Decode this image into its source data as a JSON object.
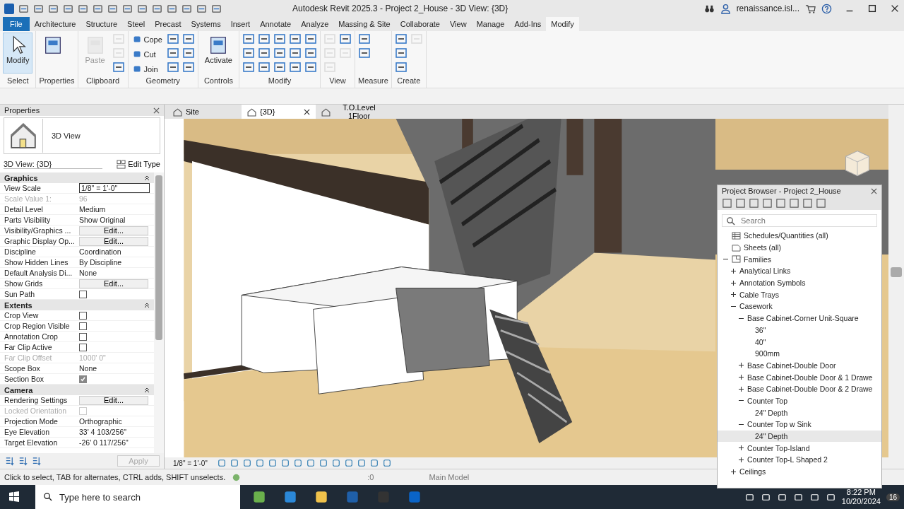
{
  "title_bar": {
    "title": "Autodesk Revit 2025.3 - Project 2_House - 3D View: {3D}",
    "user": "renaissance.isl..."
  },
  "menu_tabs": [
    {
      "label": "File",
      "kind": "file",
      "selected": false
    },
    {
      "label": "Architecture",
      "kind": "tab",
      "selected": false
    },
    {
      "label": "Structure",
      "kind": "tab",
      "selected": false
    },
    {
      "label": "Steel",
      "kind": "tab",
      "selected": false
    },
    {
      "label": "Precast",
      "kind": "tab",
      "selected": false
    },
    {
      "label": "Systems",
      "kind": "tab",
      "selected": false
    },
    {
      "label": "Insert",
      "kind": "tab",
      "selected": false
    },
    {
      "label": "Annotate",
      "kind": "tab",
      "selected": false
    },
    {
      "label": "Analyze",
      "kind": "tab",
      "selected": false
    },
    {
      "label": "Massing & Site",
      "kind": "tab",
      "selected": false
    },
    {
      "label": "Collaborate",
      "kind": "tab",
      "selected": false
    },
    {
      "label": "View",
      "kind": "tab",
      "selected": false
    },
    {
      "label": "Manage",
      "kind": "tab",
      "selected": false
    },
    {
      "label": "Add-Ins",
      "kind": "tab",
      "selected": false
    },
    {
      "label": "Modify",
      "kind": "tab",
      "selected": true
    }
  ],
  "ribbon": [
    {
      "label": "Select",
      "tools": [
        {
          "kind": "large",
          "label": "Modify",
          "selected": true,
          "disabled": false
        }
      ]
    },
    {
      "label": "Properties",
      "tools": [
        {
          "kind": "large",
          "selected": false,
          "disabled": false
        }
      ]
    },
    {
      "label": "Clipboard",
      "tools": [
        {
          "kind": "large",
          "label": "Paste",
          "selected": false,
          "disabled": true
        },
        {
          "kind": "icon",
          "disabled": true
        },
        {
          "kind": "icon",
          "disabled": true
        },
        {
          "kind": "icon",
          "disabled": false
        }
      ]
    },
    {
      "label": "Geometry",
      "tools": [
        {
          "kind": "small",
          "label": "Cope",
          "disabled": false
        },
        {
          "kind": "small",
          "label": "Cut",
          "disabled": false
        },
        {
          "kind": "small",
          "label": "Join",
          "disabled": false
        },
        {
          "kind": "icon",
          "disabled": false
        },
        {
          "kind": "icon",
          "disabled": false
        },
        {
          "kind": "icon",
          "disabled": false
        },
        {
          "kind": "icon",
          "disabled": false
        },
        {
          "kind": "icon",
          "disabled": false
        },
        {
          "kind": "icon",
          "disabled": false
        }
      ]
    },
    {
      "label": "Controls",
      "tools": [
        {
          "kind": "large",
          "label": "Activate",
          "selected": false,
          "disabled": false
        }
      ]
    },
    {
      "label": "Modify",
      "tools": [
        {
          "kind": "icon",
          "disabled": false
        },
        {
          "kind": "icon",
          "disabled": false
        },
        {
          "kind": "icon",
          "disabled": false
        },
        {
          "kind": "icon",
          "disabled": false
        },
        {
          "kind": "icon",
          "disabled": false
        },
        {
          "kind": "icon",
          "disabled": false
        },
        {
          "kind": "icon",
          "disabled": false
        },
        {
          "kind": "icon",
          "disabled": false
        },
        {
          "kind": "icon",
          "disabled": false
        },
        {
          "kind": "icon",
          "disabled": false
        },
        {
          "kind": "icon",
          "disabled": false
        },
        {
          "kind": "icon",
          "disabled": false
        },
        {
          "kind": "icon",
          "disabled": false
        },
        {
          "kind": "icon",
          "disabled": false
        },
        {
          "kind": "icon",
          "disabled": false
        }
      ]
    },
    {
      "label": "View",
      "tools": [
        {
          "kind": "icon",
          "disabled": true
        },
        {
          "kind": "icon",
          "disabled": true
        },
        {
          "kind": "icon",
          "disabled": true
        },
        {
          "kind": "icon",
          "disabled": false
        },
        {
          "kind": "icon",
          "disabled": true
        }
      ]
    },
    {
      "label": "Measure",
      "tools": [
        {
          "kind": "icon",
          "disabled": false
        },
        {
          "kind": "icon",
          "disabled": false
        }
      ]
    },
    {
      "label": "Create",
      "tools": [
        {
          "kind": "icon",
          "disabled": false
        },
        {
          "kind": "icon",
          "disabled": false
        },
        {
          "kind": "icon",
          "disabled": false
        },
        {
          "kind": "icon",
          "disabled": true
        }
      ]
    }
  ],
  "properties": {
    "title": "Properties",
    "type_name": "3D View",
    "instance": "3D View: {3D}",
    "edit_type": "Edit Type",
    "apply": "Apply",
    "sections": [
      {
        "name": "Graphics",
        "rows": [
          {
            "label": "View Scale",
            "kind": "field",
            "value": "1/8\" = 1'-0\"",
            "disabled": false
          },
          {
            "label": "Scale Value    1:",
            "kind": "text",
            "value": "96",
            "disabled": true
          },
          {
            "label": "Detail Level",
            "kind": "text",
            "value": "Medium",
            "disabled": false
          },
          {
            "label": "Parts Visibility",
            "kind": "text",
            "value": "Show Original",
            "disabled": false
          },
          {
            "label": "Visibility/Graphics ...",
            "kind": "button",
            "value": "Edit...",
            "disabled": false
          },
          {
            "label": "Graphic Display Op...",
            "kind": "button",
            "value": "Edit...",
            "disabled": false
          },
          {
            "label": "Discipline",
            "kind": "text",
            "value": "Coordination",
            "disabled": false
          },
          {
            "label": "Show Hidden Lines",
            "kind": "text",
            "value": "By Discipline",
            "disabled": false
          },
          {
            "label": "Default Analysis Di...",
            "kind": "text",
            "value": "None",
            "disabled": false
          },
          {
            "label": "Show Grids",
            "kind": "button",
            "value": "Edit...",
            "disabled": false
          },
          {
            "label": "Sun Path",
            "kind": "checkbox",
            "checked": false,
            "disabled": false
          }
        ]
      },
      {
        "name": "Extents",
        "rows": [
          {
            "label": "Crop View",
            "kind": "checkbox",
            "checked": false,
            "disabled": false
          },
          {
            "label": "Crop Region Visible",
            "kind": "checkbox",
            "checked": false,
            "disabled": false
          },
          {
            "label": "Annotation Crop",
            "kind": "checkbox",
            "checked": false,
            "disabled": false
          },
          {
            "label": "Far Clip Active",
            "kind": "checkbox",
            "checked": false,
            "disabled": false
          },
          {
            "label": "Far Clip Offset",
            "kind": "text",
            "value": "1000'  0\"",
            "disabled": true
          },
          {
            "label": "Scope Box",
            "kind": "text",
            "value": "None",
            "disabled": false
          },
          {
            "label": "Section Box",
            "kind": "checkbox",
            "checked": true,
            "disabled": false
          }
        ]
      },
      {
        "name": "Camera",
        "rows": [
          {
            "label": "Rendering Settings",
            "kind": "button",
            "value": "Edit...",
            "disabled": false
          },
          {
            "label": "Locked Orientation",
            "kind": "checkbox",
            "checked": false,
            "disabled": true
          },
          {
            "label": "Projection Mode",
            "kind": "text",
            "value": "Orthographic",
            "disabled": false
          },
          {
            "label": "Eye Elevation",
            "kind": "text",
            "value": "33'  4 103/256\"",
            "disabled": false
          },
          {
            "label": "Target Elevation",
            "kind": "text",
            "value": "-26'  0 117/256\"",
            "disabled": false
          }
        ]
      }
    ]
  },
  "view_tabs": [
    {
      "label": "Site",
      "selected": false,
      "closable": false
    },
    {
      "label": "{3D}",
      "selected": true,
      "closable": true
    },
    {
      "label": "T.O.Level 1Floor",
      "selected": false,
      "closable": false
    }
  ],
  "view_bar": {
    "scale": "1/8\" = 1'-0\""
  },
  "project_browser": {
    "title": "Project Browser - Project 2_House",
    "search_placeholder": "Search",
    "tree": [
      {
        "label": "Schedules/Quantities (all)",
        "selected": false
      },
      {
        "label": "Sheets (all)",
        "selected": false
      },
      {
        "label": "Families",
        "expanded": true,
        "selected": false,
        "children": [
          {
            "label": "Analytical Links",
            "expanded": false,
            "selected": false
          },
          {
            "label": "Annotation Symbols",
            "expanded": false,
            "selected": false
          },
          {
            "label": "Cable Trays",
            "expanded": false,
            "selected": false
          },
          {
            "label": "Casework",
            "expanded": true,
            "selected": false,
            "children": [
              {
                "label": "Base Cabinet-Corner Unit-Square",
                "expanded": true,
                "selected": false,
                "children": [
                  {
                    "label": "36\"",
                    "selected": false
                  },
                  {
                    "label": "40\"",
                    "selected": false
                  },
                  {
                    "label": "900mm",
                    "selected": false
                  }
                ]
              },
              {
                "label": "Base Cabinet-Double Door",
                "expanded": false,
                "selected": false
              },
              {
                "label": "Base Cabinet-Double Door & 1 Drawe",
                "expanded": false,
                "selected": false
              },
              {
                "label": "Base Cabinet-Double Door & 2 Drawe",
                "expanded": false,
                "selected": false
              },
              {
                "label": "Counter Top",
                "expanded": true,
                "selected": false,
                "children": [
                  {
                    "label": "24\" Depth",
                    "selected": false
                  }
                ]
              },
              {
                "label": "Counter Top w Sink",
                "expanded": true,
                "selected": false,
                "children": [
                  {
                    "label": "24\" Depth",
                    "selected": true
                  }
                ]
              },
              {
                "label": "Counter Top-Island",
                "expanded": false,
                "selected": false
              },
              {
                "label": "Counter Top-L Shaped 2",
                "expanded": false,
                "selected": false
              }
            ]
          },
          {
            "label": "Ceilings",
            "expanded": false,
            "selected": false
          }
        ]
      }
    ]
  },
  "status_bar": {
    "hint": "Click to select, TAB for alternates, CTRL adds, SHIFT unselects.",
    "count": ":0",
    "model": "Main Model"
  },
  "taskbar": {
    "search_placeholder": "Type here to search",
    "time": "8:22 PM",
    "date": "10/20/2024",
    "notifications": "16"
  }
}
